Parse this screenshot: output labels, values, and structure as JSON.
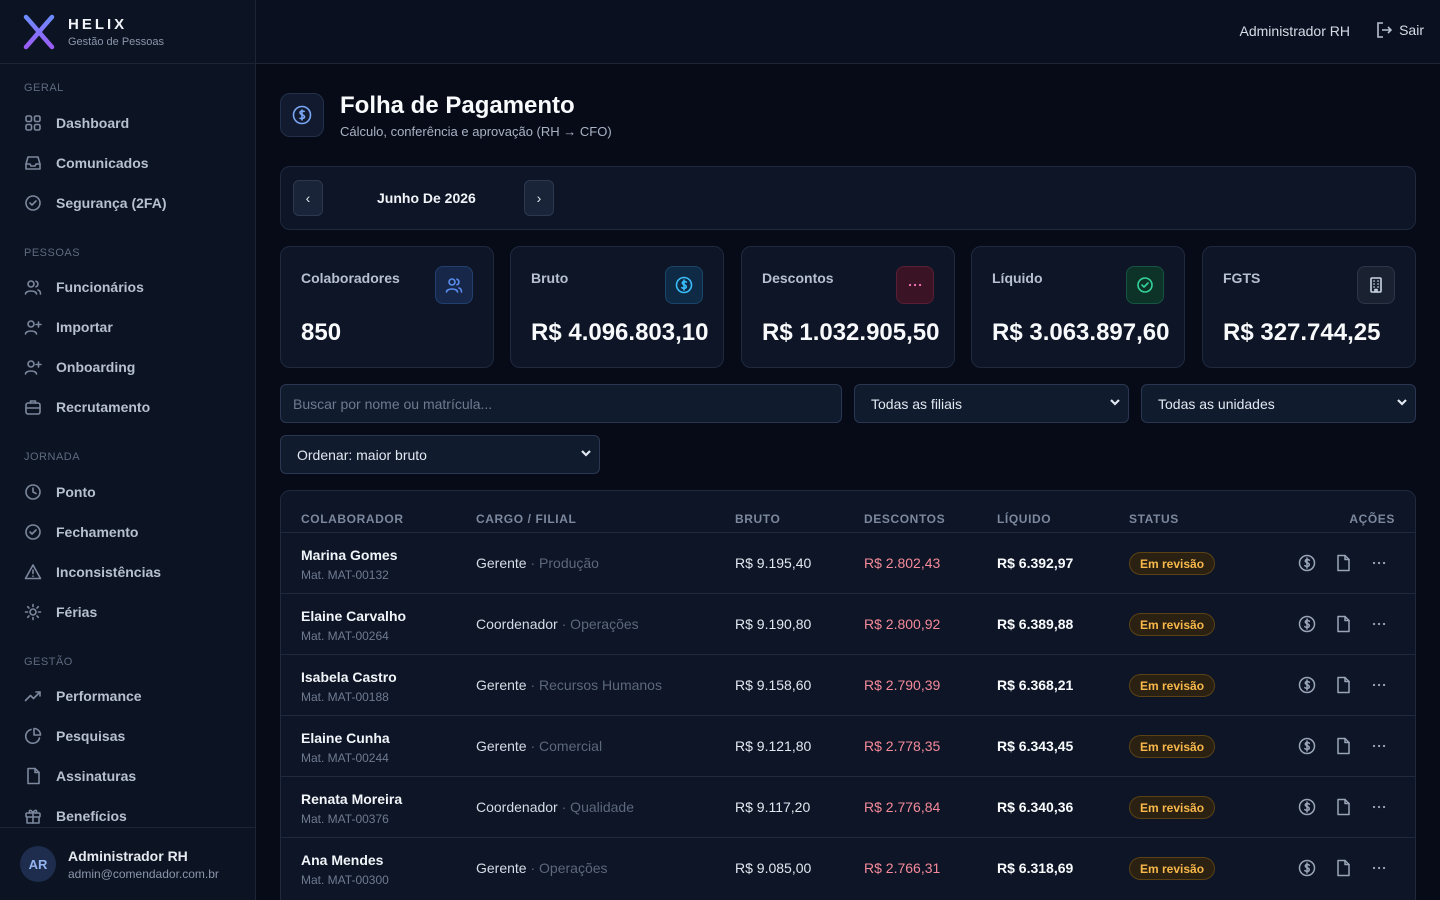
{
  "brand": {
    "name": "HELIX",
    "subtitle": "Gestão de Pessoas"
  },
  "sidebar": {
    "sections": [
      {
        "title": "GERAL",
        "items": [
          {
            "label": "Dashboard",
            "icon": "grid-icon"
          },
          {
            "label": "Comunicados",
            "icon": "inbox-icon"
          },
          {
            "label": "Segurança (2FA)",
            "icon": "check-circle-icon"
          }
        ]
      },
      {
        "title": "PESSOAS",
        "items": [
          {
            "label": "Funcionários",
            "icon": "users-icon"
          },
          {
            "label": "Importar",
            "icon": "user-plus-icon"
          },
          {
            "label": "Onboarding",
            "icon": "user-plus-icon"
          },
          {
            "label": "Recrutamento",
            "icon": "briefcase-icon"
          }
        ]
      },
      {
        "title": "JORNADA",
        "items": [
          {
            "label": "Ponto",
            "icon": "clock-icon"
          },
          {
            "label": "Fechamento",
            "icon": "check-circle-icon"
          },
          {
            "label": "Inconsistências",
            "icon": "alert-triangle-icon"
          },
          {
            "label": "Férias",
            "icon": "sun-icon"
          }
        ]
      },
      {
        "title": "GESTÃO",
        "items": [
          {
            "label": "Performance",
            "icon": "trending-up-icon"
          },
          {
            "label": "Pesquisas",
            "icon": "pie-chart-icon"
          },
          {
            "label": "Assinaturas",
            "icon": "file-icon"
          },
          {
            "label": "Benefícios",
            "icon": "gift-icon"
          }
        ]
      }
    ]
  },
  "user": {
    "initials": "AR",
    "name": "Administrador RH",
    "email": "admin@comendador.com.br"
  },
  "topbar": {
    "user": "Administrador RH",
    "logout": "Sair"
  },
  "page": {
    "title": "Folha de Pagamento",
    "subtitle": "Cálculo, conferência e aprovação (RH → CFO)"
  },
  "period": {
    "label": "Junho De 2026",
    "prev": "‹",
    "next": "›"
  },
  "kpis": [
    {
      "label": "Colaboradores",
      "value": "850",
      "icon": "users-icon",
      "color": "#5b8def"
    },
    {
      "label": "Bruto",
      "value": "R$ 4.096.803,10",
      "icon": "dollar-icon",
      "color": "#38bdf8"
    },
    {
      "label": "Descontos",
      "value": "R$ 1.032.905,50",
      "icon": "more-icon",
      "color": "#f472b6"
    },
    {
      "label": "Líquido",
      "value": "R$ 3.063.897,60",
      "icon": "check-circle-icon",
      "color": "#34d399"
    },
    {
      "label": "FGTS",
      "value": "R$ 327.744,25",
      "icon": "building-icon",
      "color": "#cbd5e1"
    }
  ],
  "filters": {
    "search_placeholder": "Buscar por nome ou matrícula...",
    "filial": "Todas as filiais",
    "unidade": "Todas as unidades",
    "ordenar": "Ordenar: maior bruto"
  },
  "table": {
    "headers": [
      "COLABORADOR",
      "CARGO / FILIAL",
      "BRUTO",
      "DESCONTOS",
      "LÍQUIDO",
      "STATUS",
      "AÇÕES"
    ],
    "rows": [
      {
        "name": "Marina Gomes",
        "mat": "Mat. MAT-00132",
        "cargo": "Gerente",
        "filial": " · Produção",
        "bruto": "R$ 9.195,40",
        "descontos": "R$ 2.802,43",
        "liquido": "R$ 6.392,97",
        "status": "Em revisão"
      },
      {
        "name": "Elaine Carvalho",
        "mat": "Mat. MAT-00264",
        "cargo": "Coordenador",
        "filial": " · Operações",
        "bruto": "R$ 9.190,80",
        "descontos": "R$ 2.800,92",
        "liquido": "R$ 6.389,88",
        "status": "Em revisão"
      },
      {
        "name": "Isabela Castro",
        "mat": "Mat. MAT-00188",
        "cargo": "Gerente",
        "filial": " · Recursos Humanos",
        "bruto": "R$ 9.158,60",
        "descontos": "R$ 2.790,39",
        "liquido": "R$ 6.368,21",
        "status": "Em revisão"
      },
      {
        "name": "Elaine Cunha",
        "mat": "Mat. MAT-00244",
        "cargo": "Gerente",
        "filial": " · Comercial",
        "bruto": "R$ 9.121,80",
        "descontos": "R$ 2.778,35",
        "liquido": "R$ 6.343,45",
        "status": "Em revisão"
      },
      {
        "name": "Renata Moreira",
        "mat": "Mat. MAT-00376",
        "cargo": "Coordenador",
        "filial": " · Qualidade",
        "bruto": "R$ 9.117,20",
        "descontos": "R$ 2.776,84",
        "liquido": "R$ 6.340,36",
        "status": "Em revisão"
      },
      {
        "name": "Ana Mendes",
        "mat": "Mat. MAT-00300",
        "cargo": "Gerente",
        "filial": " · Operações",
        "bruto": "R$ 9.085,00",
        "descontos": "R$ 2.766,31",
        "liquido": "R$ 6.318,69",
        "status": "Em revisão"
      }
    ]
  }
}
